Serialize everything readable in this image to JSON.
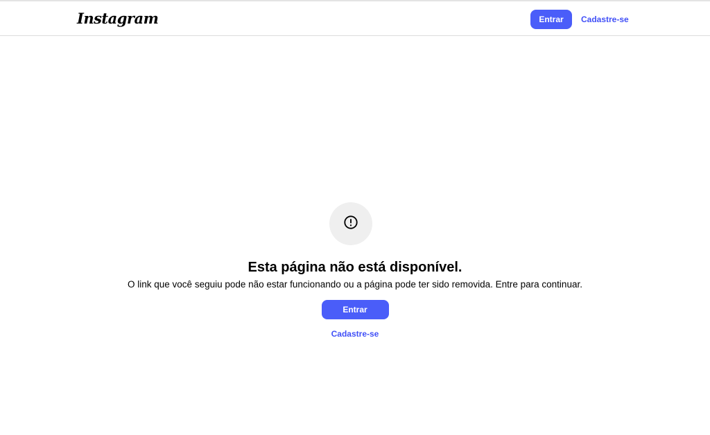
{
  "header": {
    "logo_text": "Instagram",
    "login_label": "Entrar",
    "signup_label": "Cadastre-se"
  },
  "error": {
    "icon": "alert-circle-icon",
    "title": "Esta página não está disponível.",
    "description": "O link que você seguiu pode não estar funcionando ou a página pode ter sido removida. Entre para continuar.",
    "login_label": "Entrar",
    "signup_label": "Cadastre-se"
  },
  "colors": {
    "accent": "#4a5df9",
    "link": "#4150f7",
    "icon_bg": "#efefef"
  }
}
